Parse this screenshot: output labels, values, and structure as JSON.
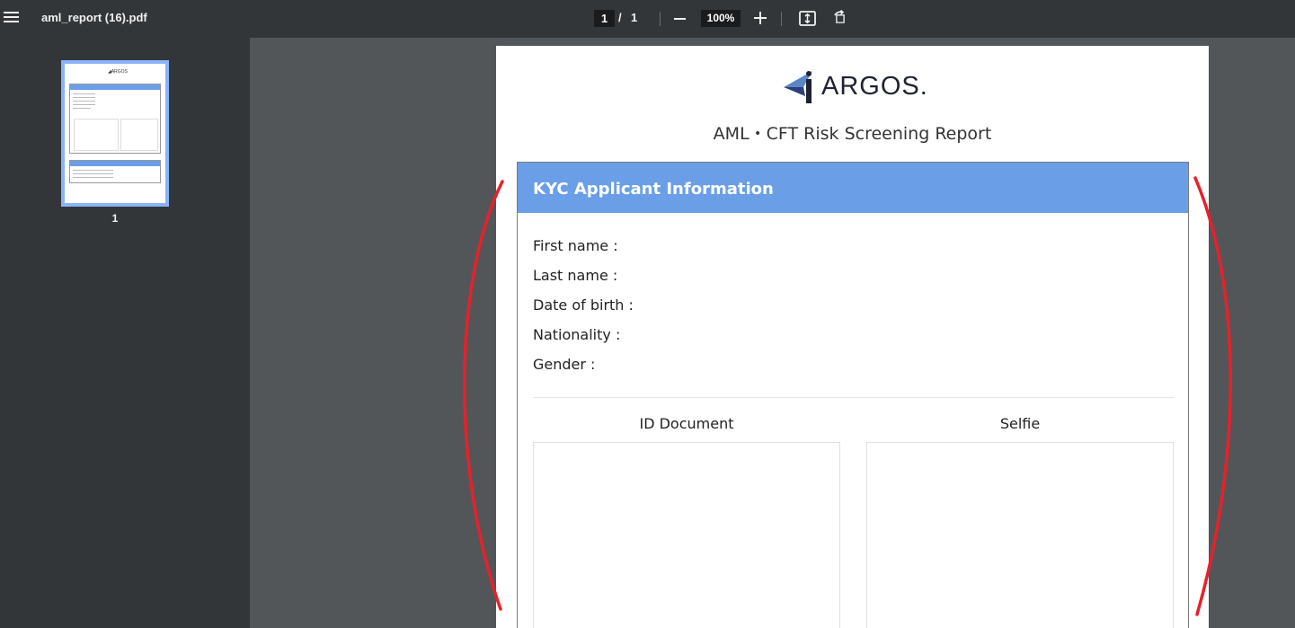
{
  "viewer": {
    "file_name": "aml_report (16).pdf",
    "current_page": "1",
    "page_separator": "/",
    "total_pages": "1",
    "zoom": "100%"
  },
  "sidebar": {
    "thumbnail_page_number": "1"
  },
  "report": {
    "logo_text": "ARGOS.",
    "title": "AML・CFT Risk Screening Report",
    "section_title": "KYC Applicant Information",
    "fields": [
      "First name :",
      "Last name :",
      "Date of birth :",
      "Nationality :",
      "Gender :"
    ],
    "id_document_label": "ID Document",
    "selfie_label": "Selfie"
  },
  "colors": {
    "toolbar": "#323639",
    "viewer_bg": "#525659",
    "section_header": "#6a9fe8",
    "annotation": "#e8202a"
  }
}
